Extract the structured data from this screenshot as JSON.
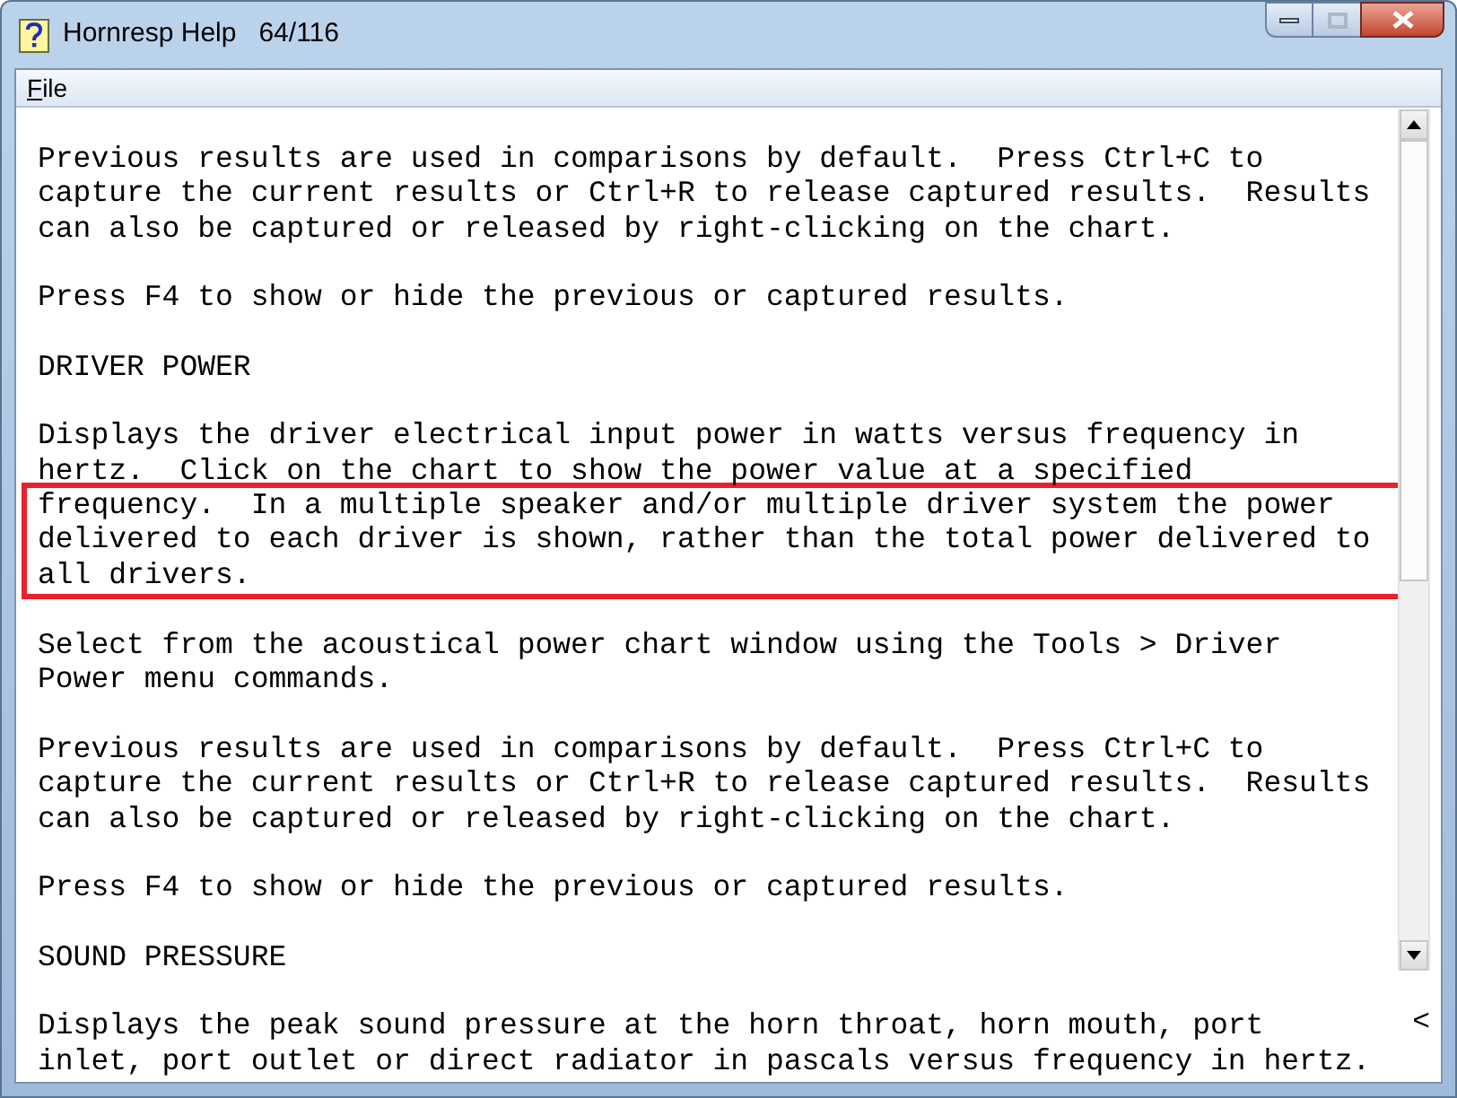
{
  "window": {
    "title": "Hornresp Help",
    "page": "64/116"
  },
  "menu": [
    {
      "label": "File"
    }
  ],
  "paragraphs": [
    {
      "lines": [
        {
          "text": "Previous results are used in comparisons by default.  Press Ctrl+C to",
          "highlighted": false
        },
        {
          "text": "capture the current results or Ctrl+R to release captured results.  Results",
          "highlighted": false
        },
        {
          "text": "can also be captured or released by right-clicking on the chart.",
          "highlighted": false
        }
      ]
    },
    {
      "lines": [
        {
          "text": "Press F4 to show or hide the previous or captured results.",
          "highlighted": false
        }
      ]
    },
    {
      "lines": [
        {
          "text": "DRIVER POWER",
          "highlighted": false
        }
      ]
    },
    {
      "lines": [
        {
          "text": "Displays the driver electrical input power in watts versus frequency in",
          "highlighted": false
        },
        {
          "text": "hertz.  Click on the chart to show the power value at a specified",
          "highlighted": false
        },
        {
          "text": "frequency.  In a multiple speaker and/or multiple driver system the power",
          "highlighted": true
        },
        {
          "text": "delivered to each driver is shown, rather than the total power delivered to",
          "highlighted": true
        },
        {
          "text": "all drivers.",
          "highlighted": true
        }
      ]
    },
    {
      "lines": [
        {
          "text": "Select from the acoustical power chart window using the Tools > Driver",
          "highlighted": false
        },
        {
          "text": "Power menu commands.",
          "highlighted": false
        }
      ]
    },
    {
      "lines": [
        {
          "text": "Previous results are used in comparisons by default.  Press Ctrl+C to",
          "highlighted": false
        },
        {
          "text": "capture the current results or Ctrl+R to release captured results.  Results",
          "highlighted": false
        },
        {
          "text": "can also be captured or released by right-clicking on the chart.",
          "highlighted": false
        }
      ]
    },
    {
      "lines": [
        {
          "text": "Press F4 to show or hide the previous or captured results.",
          "highlighted": false
        }
      ]
    },
    {
      "lines": [
        {
          "text": "SOUND PRESSURE",
          "highlighted": false
        }
      ]
    },
    {
      "lines": [
        {
          "text": "Displays the peak sound pressure at the horn throat, horn mouth, port",
          "highlighted": false
        },
        {
          "text": "inlet, port outlet or direct radiator in pascals versus frequency in hertz.",
          "highlighted": false
        }
      ]
    }
  ],
  "edge_mark": "<"
}
